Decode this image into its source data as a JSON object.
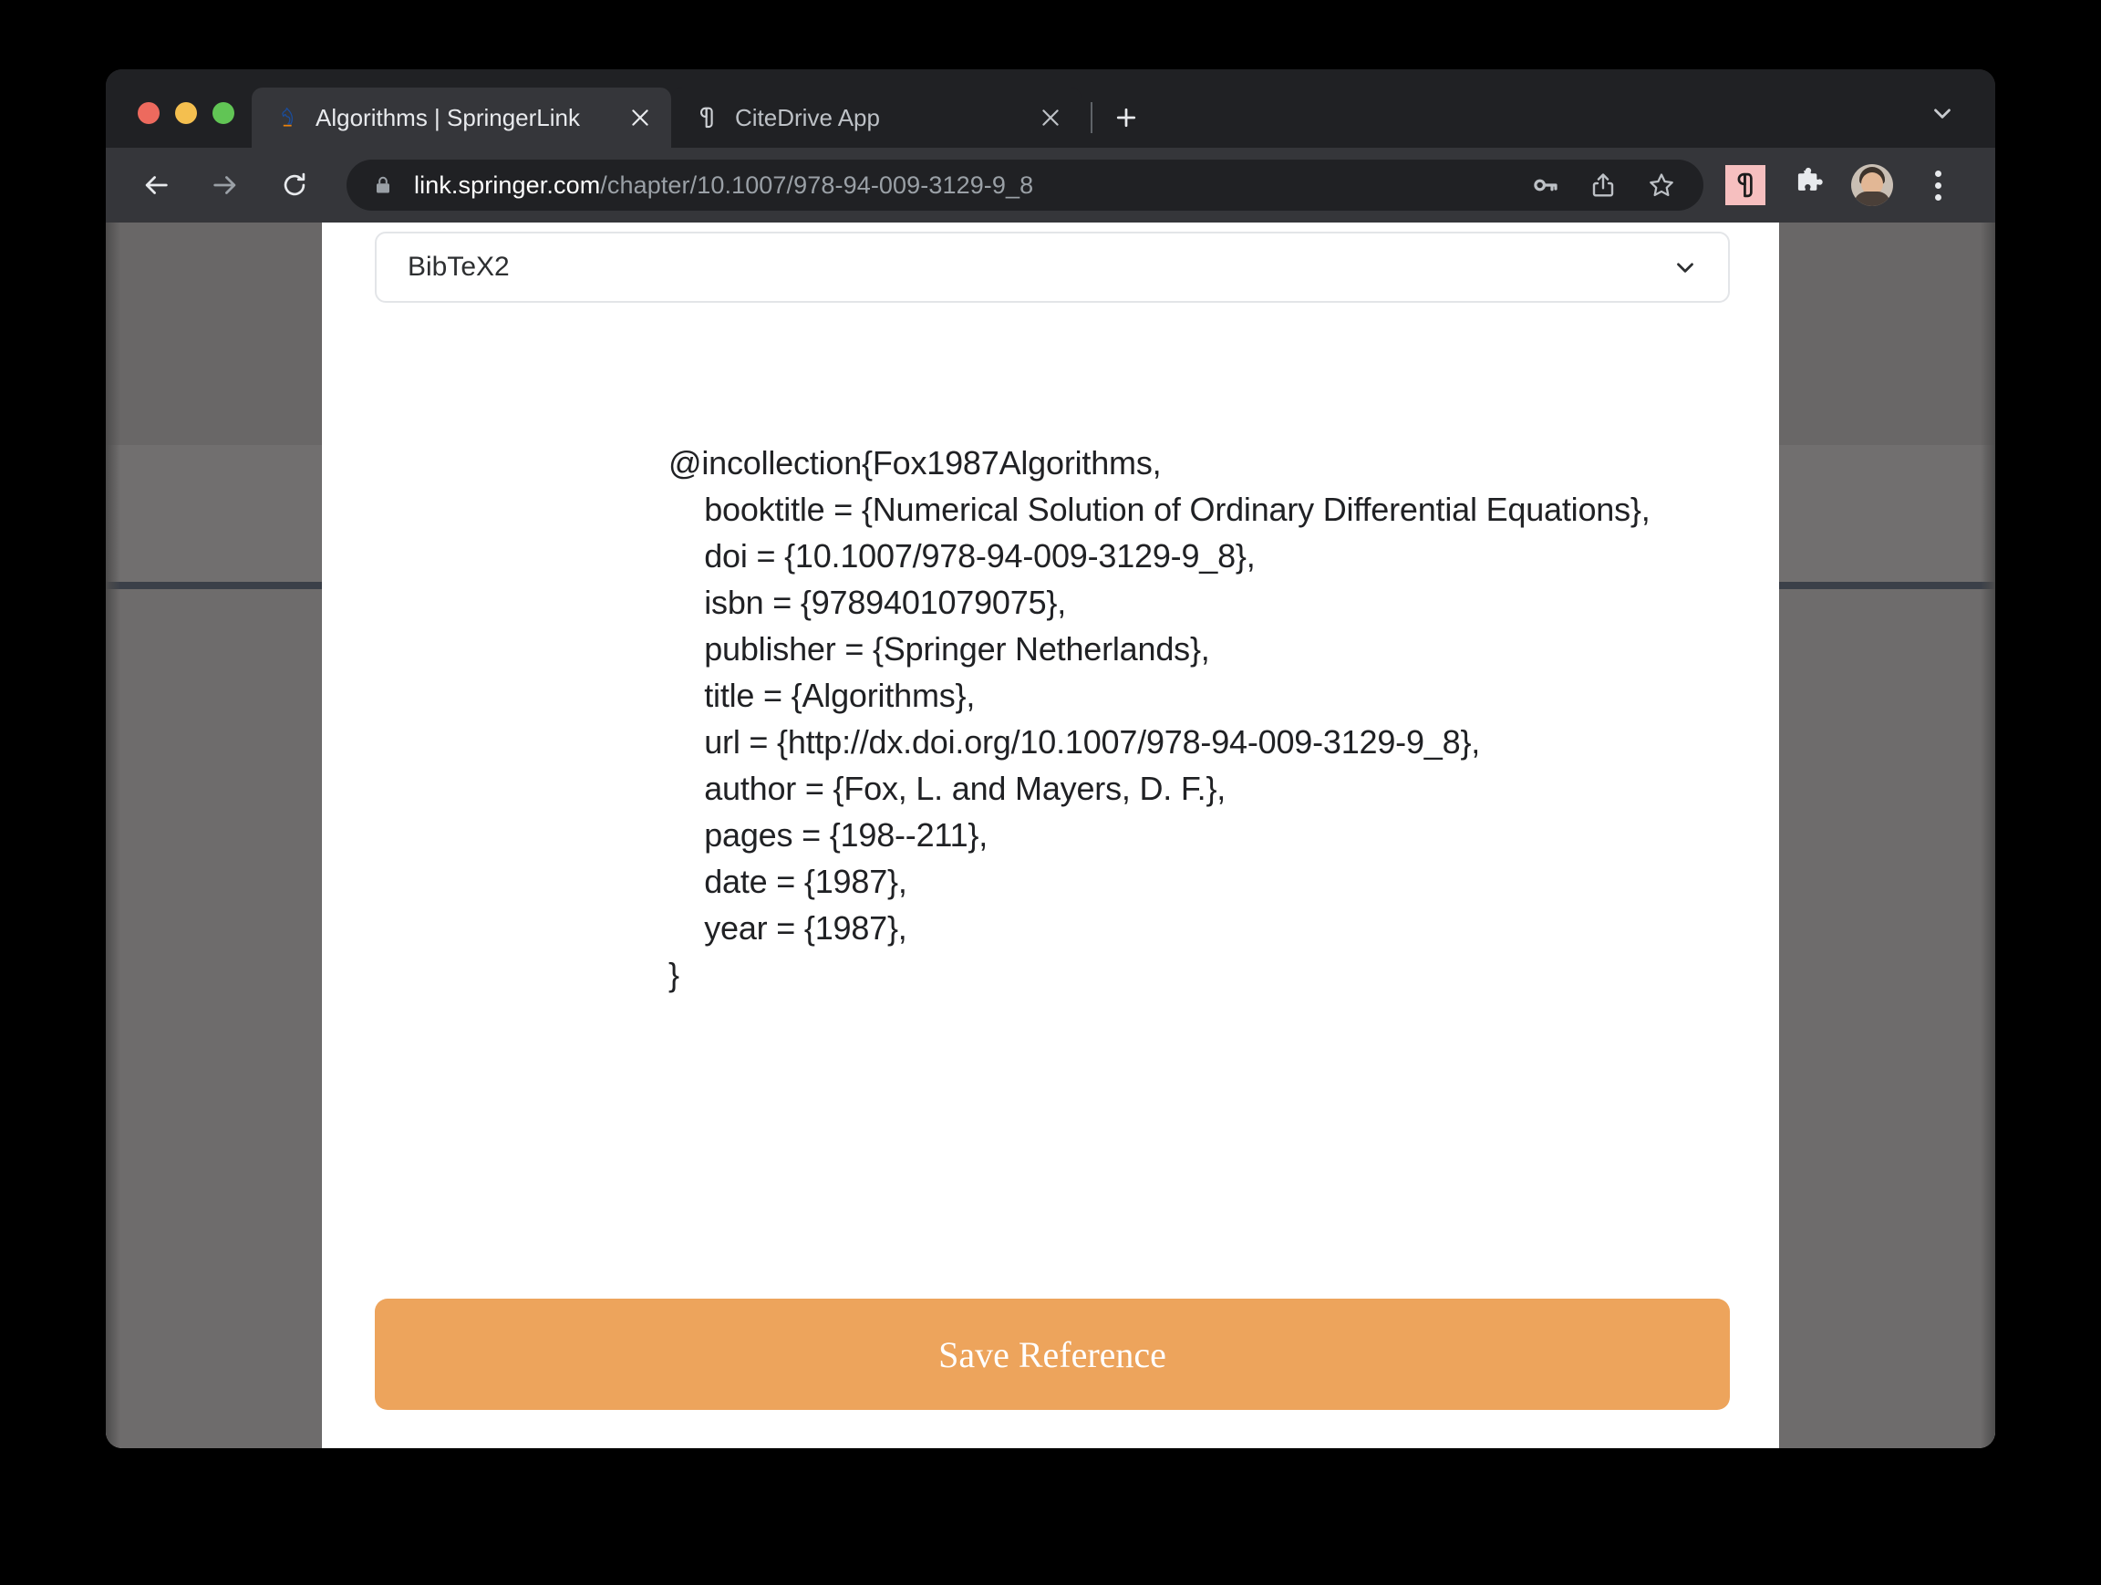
{
  "window": {
    "traffic_lights": [
      "close",
      "minimize",
      "maximize"
    ]
  },
  "tabs": [
    {
      "title": "Algorithms | SpringerLink",
      "favicon": "springer-knight-icon",
      "active": true,
      "close_label": "×"
    },
    {
      "title": "CiteDrive App",
      "favicon": "citedrive-monogram-icon",
      "active": false,
      "close_label": "×"
    }
  ],
  "tab_strip": {
    "new_tab_label": "+",
    "tab_list_label": "⌄"
  },
  "toolbar": {
    "back_label": "←",
    "forward_label": "→",
    "reload_label": "⟳",
    "url_domain": "link.springer.com",
    "url_path": "/chapter/10.1007/978-94-009-3129-9_8",
    "url_full": "link.springer.com/chapter/10.1007/978-94-009-3129-9_8",
    "actions": [
      "password-key-icon",
      "share-icon",
      "bookmark-star-icon"
    ],
    "extensions": [
      "citedrive-extension-icon",
      "puzzle-extensions-icon"
    ],
    "profile": "user-avatar",
    "menu_label": "⋮"
  },
  "panel": {
    "format_select": {
      "value": "BibTeX2",
      "chevron": "chevron-down-icon"
    },
    "bibtex": "@incollection{Fox1987Algorithms,\n    booktitle = {Numerical Solution of Ordinary Differential Equations},\n    doi = {10.1007/978-94-009-3129-9_8},\n    isbn = {9789401079075},\n    publisher = {Springer Netherlands},\n    title = {Algorithms},\n    url = {http://dx.doi.org/10.1007/978-94-009-3129-9_8},\n    author = {Fox, L. and Mayers, D. F.},\n    pages = {198--211},\n    date = {1987},\n    year = {1987},\n}",
    "bibtex_fields": {
      "entry_type": "incollection",
      "citation_key": "Fox1987Algorithms",
      "booktitle": "Numerical Solution of Ordinary Differential Equations",
      "doi": "10.1007/978-94-009-3129-9_8",
      "isbn": "9789401079075",
      "publisher": "Springer Netherlands",
      "title": "Algorithms",
      "url": "http://dx.doi.org/10.1007/978-94-009-3129-9_8",
      "author": "Fox, L. and Mayers, D. F.",
      "pages": "198--211",
      "date": "1987",
      "year": "1987"
    },
    "save_button_label": "Save Reference"
  },
  "colors": {
    "accent_orange": "#eda45c",
    "extension_badge_pink": "#f6bfbf",
    "tab_strip_bg": "#202124",
    "toolbar_bg": "#35363a",
    "omnibox_bg": "#202124",
    "backdrop_gray": "#6e6c6c",
    "panel_bg": "#ffffff"
  }
}
